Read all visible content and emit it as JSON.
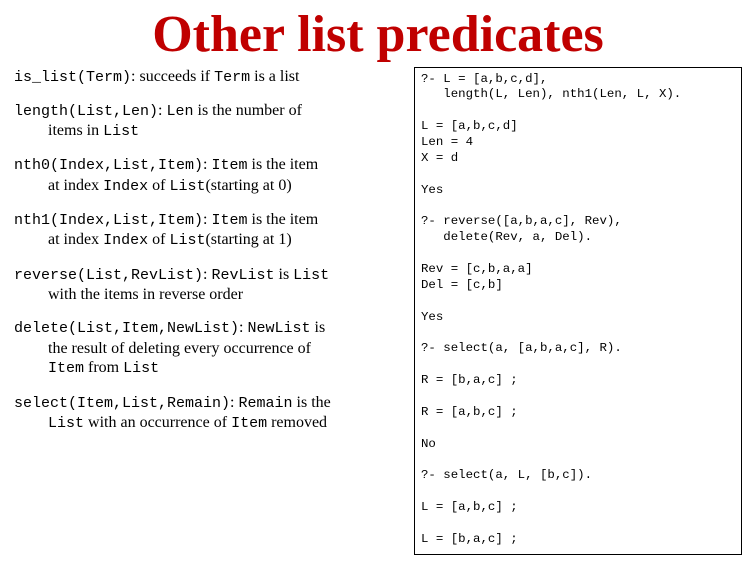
{
  "title": "Other list predicates",
  "predicates": {
    "is_list": {
      "sig": "is_list(Term)",
      "d1a": ": succeeds if ",
      "d1c": "Term",
      "d1b": " is a list"
    },
    "length": {
      "sig": "length(List,Len)",
      "d1a": ": ",
      "d1c": "Len",
      "d1b": " is the number of",
      "d2a": "items in ",
      "d2c": "List"
    },
    "nth0": {
      "sig": "nth0(Index,List,Item)",
      "d1a": ": ",
      "d1c": "Item",
      "d1b": " is the item",
      "d2a": "at index ",
      "d2c": "Index",
      "d2b": " of ",
      "d2d": "List",
      "d2e": "(starting at 0)"
    },
    "nth1": {
      "sig": "nth1(Index,List,Item)",
      "d1a": ": ",
      "d1c": "Item",
      "d1b": " is the item",
      "d2a": "at index ",
      "d2c": "Index",
      "d2b": " of ",
      "d2d": "List",
      "d2e": "(starting at 1)"
    },
    "reverse": {
      "sig": "reverse(List,RevList)",
      "d1a": ": ",
      "d1c": "RevList",
      "d1b": " is ",
      "d1d": "List",
      "d2a": "with the items in reverse order"
    },
    "delete": {
      "sig": "delete(List,Item,NewList)",
      "d1a": ": ",
      "d1c": "NewList",
      "d1b": " is",
      "d2a": "the result of deleting every occurrence of",
      "d3c": "Item",
      "d3a": " from ",
      "d3d": "List"
    },
    "select": {
      "sig": "select(Item,List,Remain)",
      "d1a": ": ",
      "d1c": "Remain",
      "d1b": " is the",
      "d2c": "List",
      "d2a": " with an occurrence of ",
      "d2d": "Item",
      "d2b": " removed"
    }
  },
  "terminal": "?- L = [a,b,c,d],\n   length(L, Len), nth1(Len, L, X).\n\nL = [a,b,c,d]\nLen = 4\nX = d\n\nYes\n\n?- reverse([a,b,a,c], Rev),\n   delete(Rev, a, Del).\n\nRev = [c,b,a,a]\nDel = [c,b]\n\nYes\n\n?- select(a, [a,b,a,c], R).\n\nR = [b,a,c] ;\n\nR = [a,b,c] ;\n\nNo\n\n?- select(a, L, [b,c]).\n\nL = [a,b,c] ;\n\nL = [b,a,c] ;\n\nL = [b,c,a] ;\n\nNo"
}
